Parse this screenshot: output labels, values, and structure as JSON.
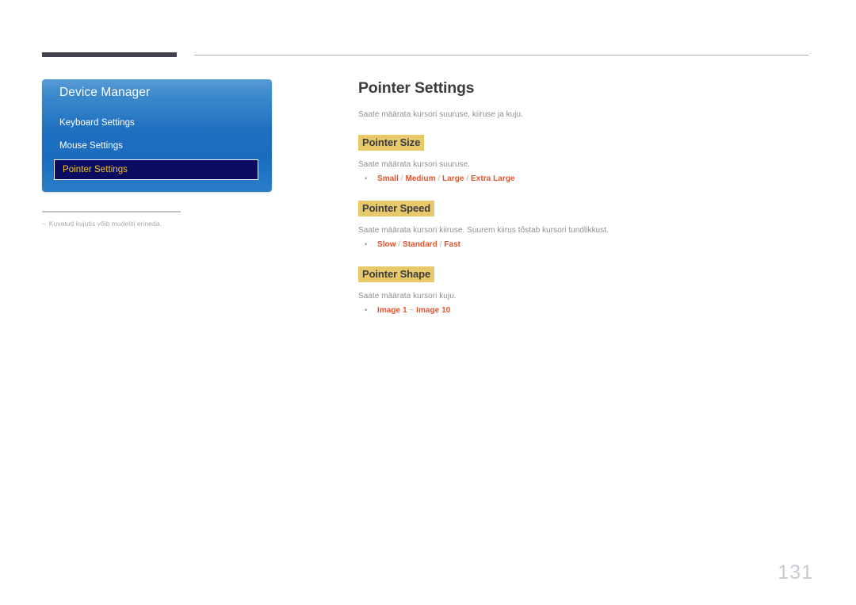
{
  "header": {
    "rule_dark_color": "#45424e",
    "rule_light_color": "#a8a8ae"
  },
  "osd": {
    "title": "Device Manager",
    "panel_color": "#1f6fc0",
    "selected_fill": "#0b0b62",
    "selected_text_color": "#f5c518",
    "items": [
      {
        "label": "Keyboard Settings",
        "selected": false
      },
      {
        "label": "Mouse Settings",
        "selected": false
      },
      {
        "label": "Pointer Settings",
        "selected": true
      }
    ]
  },
  "footnote": {
    "dash": "–",
    "text": "Kuvatud kujutis võib mudeliti erineda."
  },
  "main": {
    "title": "Pointer Settings",
    "intro": "Saate määrata kursori suuruse, kiiruse ja kuju.",
    "highlight_color": "#e8c96a",
    "option_color": "#e0542e",
    "bullet": "•",
    "sections": [
      {
        "heading": "Pointer Size",
        "description": "Saate määrata kursori suuruse.",
        "options": [
          "Small",
          "Medium",
          "Large",
          "Extra Large"
        ],
        "separator": "/"
      },
      {
        "heading": "Pointer Speed",
        "description": "Saate määrata kursori kiiruse. Suurem kiirus tõstab kursori tundlikkust.",
        "options": [
          "Slow",
          "Standard",
          "Fast"
        ],
        "separator": "/"
      },
      {
        "heading": "Pointer Shape",
        "description": "Saate määrata kursori kuju.",
        "options": [
          "Image 1",
          "Image 10"
        ],
        "separator": "~"
      }
    ]
  },
  "footer": {
    "page_number": "131"
  }
}
